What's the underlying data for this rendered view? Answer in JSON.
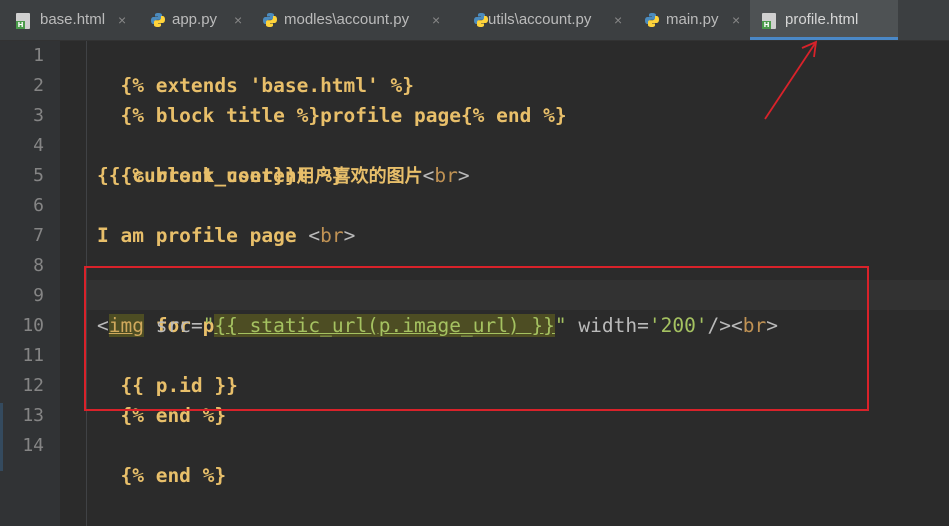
{
  "tabs": [
    {
      "label": "base.html",
      "icon": "html-file-icon",
      "active": false
    },
    {
      "label": "app.py",
      "icon": "python-file-icon",
      "active": false
    },
    {
      "label": "modles\\account.py",
      "icon": "python-file-icon",
      "active": false
    },
    {
      "label": "utils\\account.py",
      "icon": "python-file-icon",
      "active": false
    },
    {
      "label": "main.py",
      "icon": "python-file-icon",
      "active": false
    },
    {
      "label": "profile.html",
      "icon": "html-file-icon",
      "active": true
    }
  ],
  "close_glyph": "×",
  "line_numbers": [
    "1",
    "2",
    "3",
    "4",
    "5",
    "6",
    "7",
    "8",
    "9",
    "10",
    "11",
    "12",
    "13",
    "14"
  ],
  "code": {
    "l1": "{% extends 'base.html' %}",
    "l2": "{% block title %}profile page{% end %}",
    "l4": "{% block content %}",
    "l5_tpl": "{{ current_user}}",
    "l5_cjk": "用户喜欢的图片",
    "l5_tag_open": "<",
    "l5_tag_name": "br",
    "l5_tag_close": ">",
    "l7_text": "I am profile page ",
    "l7_tag_open": "<",
    "l7_tag_name": "br",
    "l7_tag_close": ">",
    "l9": "{% for p in like_posts %}",
    "l10_lt": "<",
    "l10_img": "img",
    "l10_src": " src=",
    "l10_q1": "\"",
    "l10_inj": "{{ static_url(p.image_url) }}",
    "l10_q2": "\"",
    "l10_width": " width=",
    "l10_wval": "'200'",
    "l10_end": "/><",
    "l10_br": "br",
    "l10_gt": ">",
    "l11": "{{ p.id }}",
    "l12": "{% end %}",
    "l14": "{% end %}"
  },
  "colors": {
    "background": "#2b2b2b",
    "template_tag": "#e8bf6a",
    "string": "#a5c261",
    "annotation_red": "#d9222a"
  }
}
